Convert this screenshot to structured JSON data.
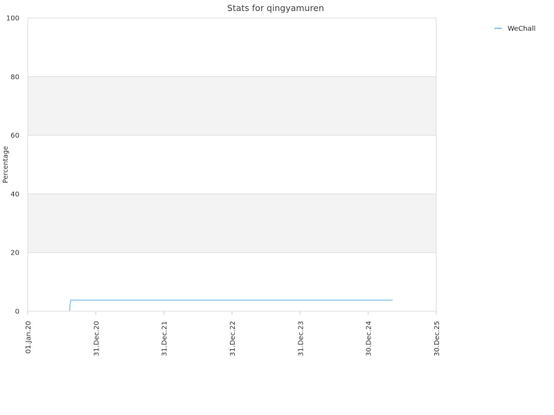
{
  "chart_data": {
    "type": "line",
    "title": "Stats for qingyamuren",
    "xlabel": "",
    "ylabel": "Percentage",
    "ylim": [
      0,
      100
    ],
    "yticks": [
      0,
      20,
      40,
      60,
      80,
      100
    ],
    "xlim": [
      "2020-01-01",
      "2025-12-30"
    ],
    "xticks": [
      {
        "date": "2020-01-01",
        "label": "01.Jan.20"
      },
      {
        "date": "2020-12-31",
        "label": "31.Dec.20"
      },
      {
        "date": "2021-12-31",
        "label": "31.Dec.21"
      },
      {
        "date": "2022-12-31",
        "label": "31.Dec.22"
      },
      {
        "date": "2023-12-31",
        "label": "31.Dec.23"
      },
      {
        "date": "2024-12-30",
        "label": "30.Dec.24"
      },
      {
        "date": "2025-12-30",
        "label": "30.Dec.25"
      }
    ],
    "grid": true,
    "legend_position": "top-right",
    "colors": {
      "WeChall": "#8fc4ea",
      "band": "#f3f3f3",
      "axis": "#dddddd"
    },
    "series": [
      {
        "name": "WeChall",
        "points": [
          {
            "x": "2020-08-13",
            "y": 0
          },
          {
            "x": "2020-08-14",
            "y": 1.5
          },
          {
            "x": "2020-08-16",
            "y": 2.5
          },
          {
            "x": "2020-08-19",
            "y": 3.8
          },
          {
            "x": "2025-05-10",
            "y": 3.8
          }
        ]
      }
    ]
  }
}
